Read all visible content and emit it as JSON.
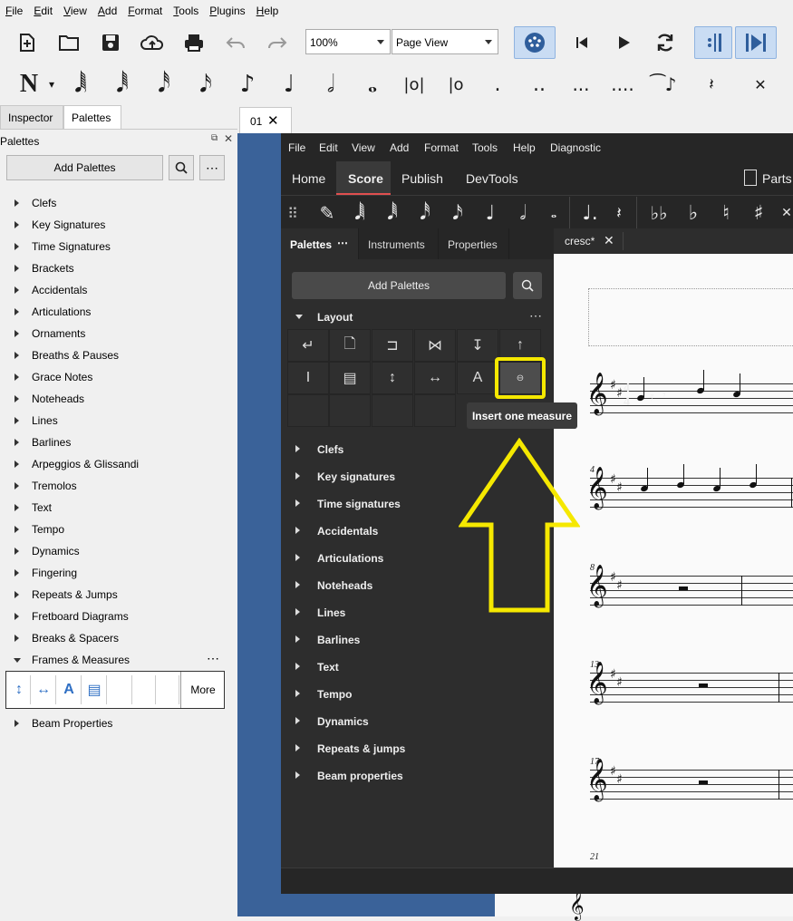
{
  "outer": {
    "menu": [
      "File",
      "Edit",
      "View",
      "Add",
      "Format",
      "Tools",
      "Plugins",
      "Help"
    ],
    "zoom": "100%",
    "view_mode": "Page View",
    "panel_tabs": [
      "Inspector",
      "Palettes"
    ],
    "palettes_title": "Palettes",
    "add_palettes": "Add Palettes",
    "palette_items": [
      "Clefs",
      "Key Signatures",
      "Time Signatures",
      "Brackets",
      "Accidentals",
      "Articulations",
      "Ornaments",
      "Breaths & Pauses",
      "Grace Notes",
      "Noteheads",
      "Lines",
      "Barlines",
      "Arpeggios & Glissandi",
      "Tremolos",
      "Text",
      "Tempo",
      "Dynamics",
      "Fingering",
      "Repeats & Jumps",
      "Fretboard Diagrams",
      "Breaks & Spacers",
      "Frames & Measures"
    ],
    "expanded_more": "More",
    "last_item": "Beam Properties",
    "doc_tab": "01"
  },
  "inner": {
    "menu": [
      "File",
      "Edit",
      "View",
      "Add",
      "Format",
      "Tools",
      "Help",
      "Diagnostic"
    ],
    "nav": [
      "Home",
      "Score",
      "Publish",
      "DevTools"
    ],
    "parts": "Parts",
    "left_tabs": [
      "Palettes",
      "Instruments",
      "Properties"
    ],
    "add_palettes": "Add Palettes",
    "layout_section": "Layout",
    "tooltip": "Insert one measure",
    "sections": [
      "Clefs",
      "Key signatures",
      "Time signatures",
      "Accidentals",
      "Articulations",
      "Noteheads",
      "Lines",
      "Barlines",
      "Text",
      "Tempo",
      "Dynamics",
      "Repeats & jumps",
      "Beam properties"
    ],
    "score_tab": "cresc*",
    "measure_numbers": [
      "4",
      "8",
      "13",
      "17",
      "21"
    ],
    "time_sig": "4"
  },
  "colors": {
    "highlight": "#f5e800",
    "accent_red": "#e04f4f",
    "score_bg": "#3a6299"
  }
}
